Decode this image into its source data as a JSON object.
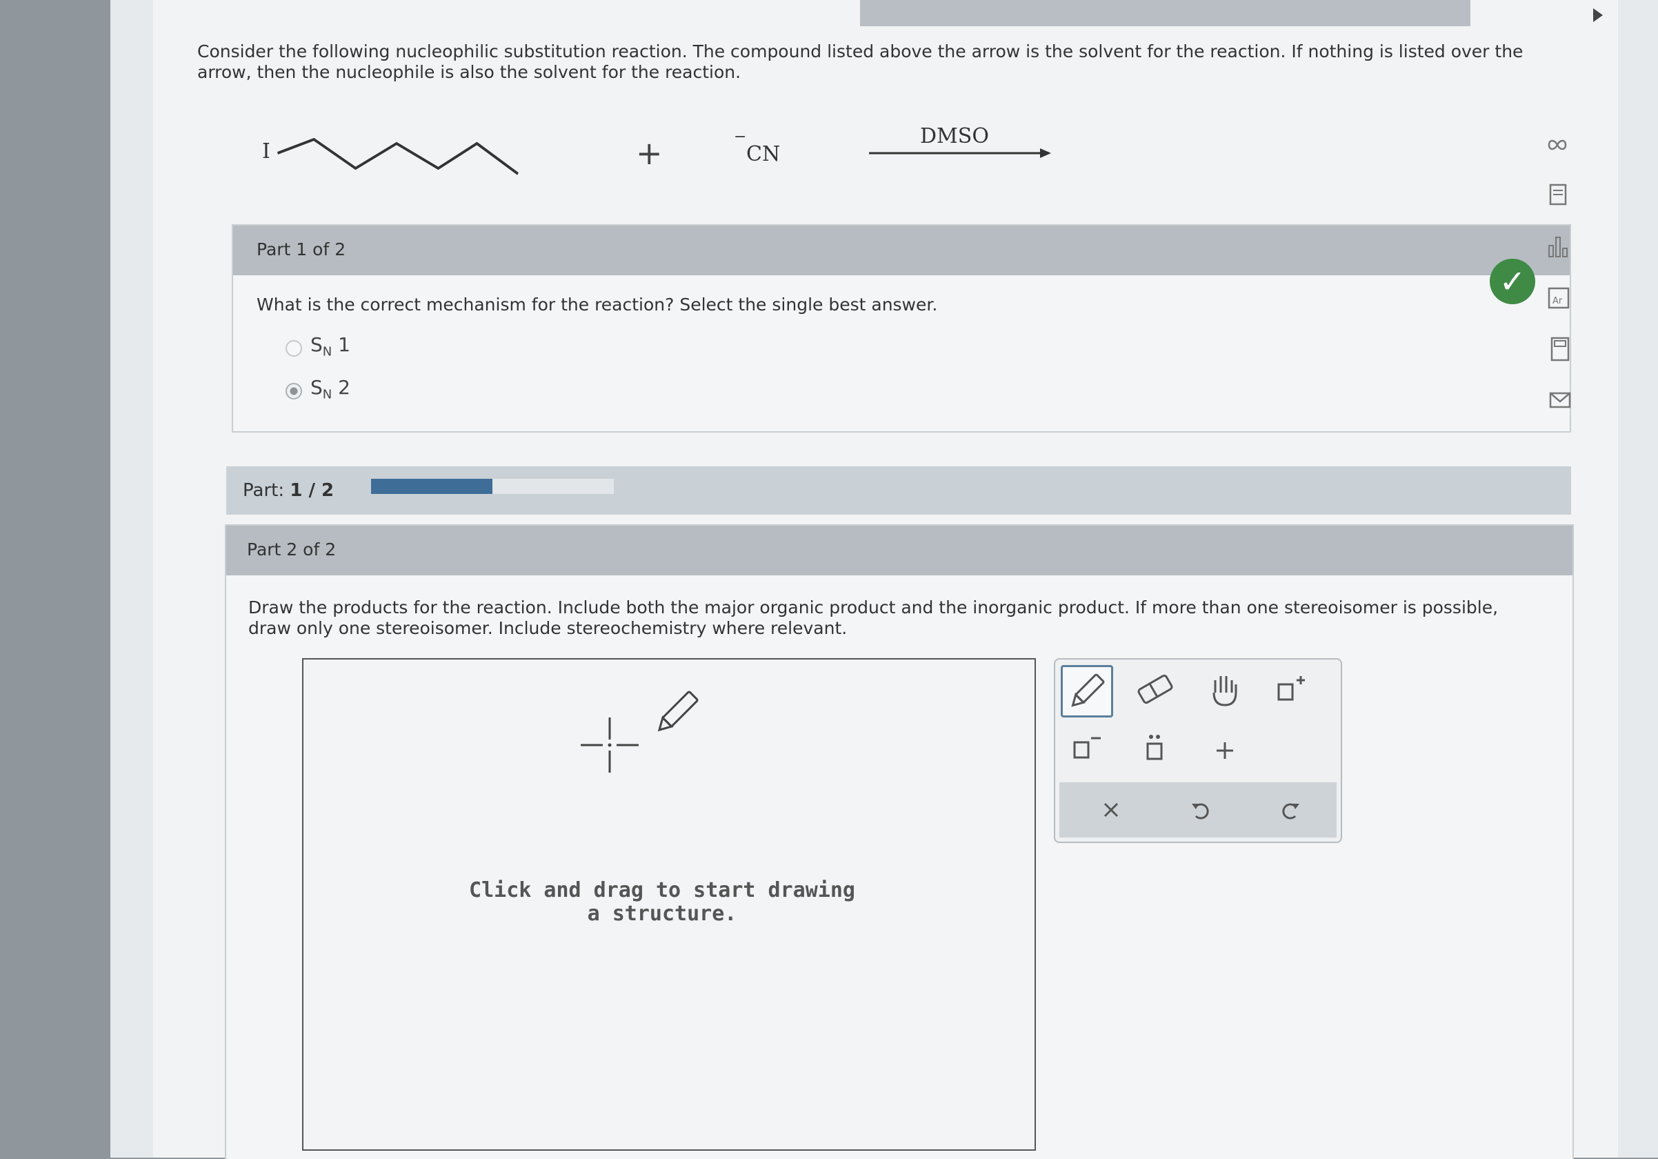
{
  "instructions": "Consider the following nucleophilic substitution reaction. The compound listed above the arrow is the solvent for the reaction. If nothing is listed over the arrow, then the nucleophile is also the solvent for the reaction.",
  "reaction": {
    "substrate_atom": "I",
    "plus": "+",
    "nucleophile_charge": "−",
    "nucleophile": "CN",
    "solvent": "DMSO"
  },
  "part1": {
    "header": "Part 1 of 2",
    "question": "What is the correct mechanism for the reaction? Select the single best answer.",
    "options": [
      {
        "main": "S",
        "sub": "N",
        "num": "1",
        "selected": false
      },
      {
        "main": "S",
        "sub": "N",
        "num": "2",
        "selected": true
      }
    ],
    "status": "correct"
  },
  "progress": {
    "label": "Part:",
    "value": "1 / 2",
    "fraction": 0.5
  },
  "part2": {
    "header": "Part 2 of 2",
    "question": "Draw the products for the reaction. Include both the major organic product and the inorganic product. If more than one stereoisomer is possible, draw only one stereoisomer. Include stereochemistry where relevant.",
    "canvas_hint": "Click and drag to start drawing a structure."
  },
  "toolbar": {
    "tools": [
      "pencil-icon",
      "eraser-icon",
      "hand-icon",
      "charge-plus-icon",
      "charge-minus-icon",
      "lone-pair-icon",
      "plus-icon"
    ],
    "actions": [
      "clear-icon",
      "undo-icon",
      "redo-icon"
    ],
    "active_tool": "pencil-icon"
  },
  "side_icons": [
    "infinity-icon",
    "book-icon",
    "bar-chart-icon",
    "periodic-table-icon",
    "calculator-icon",
    "mail-icon"
  ],
  "colors": {
    "accent": "#3e6d98",
    "success": "#3f8a45"
  }
}
